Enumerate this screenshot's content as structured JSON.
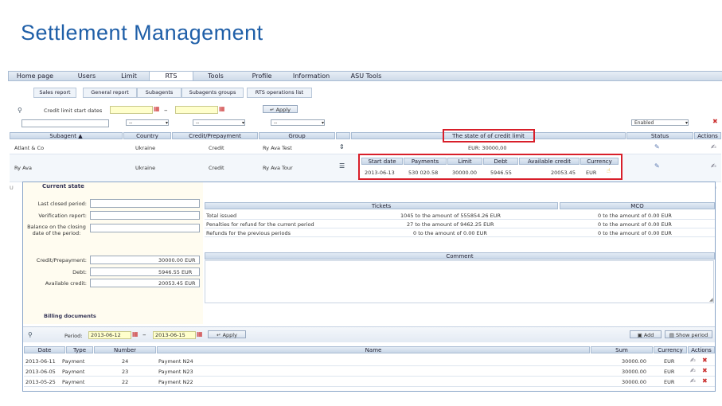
{
  "slide_title": "Settlement Management",
  "nav": [
    "Home page",
    "Users",
    "Limit",
    "RTS",
    "Tools",
    "Profile",
    "Information",
    "ASU Tools"
  ],
  "nav_active": "RTS",
  "subnav": [
    "Sales report",
    "General report",
    "Subagents",
    "Subagents groups",
    "RTS operations list"
  ],
  "filters": {
    "credit_limit_label": "Credit limit start dates",
    "dash": "–",
    "apply": "Apply",
    "sel1": "--",
    "sel2": "--",
    "sel3": "--",
    "enabled": "Enabled"
  },
  "main_table": {
    "headers": [
      "Subagent ▲",
      "Country",
      "Credit/Prepayment",
      "Group",
      "The state of of credit limit",
      "Status",
      "Actions"
    ],
    "rows": [
      {
        "subagent": "Atlant & Co",
        "country": "Ukraine",
        "credit": "Credit",
        "group": "Ry Ava Test",
        "state": "EUR: 30000,00"
      },
      {
        "subagent": "Ry Ava",
        "country": "Ukraine",
        "credit": "Credit",
        "group": "Ry Ava Tour"
      }
    ]
  },
  "credit_detail": {
    "headers": [
      "Start date",
      "Payments",
      "Limit",
      "Debt",
      "Available credit",
      "Currency"
    ],
    "values": [
      "2013-06-13",
      "530 020.58",
      "30000.00",
      "5946.55",
      "20053.45",
      "EUR"
    ]
  },
  "current_state": {
    "title": "Current state",
    "labels": [
      "Last closed period:",
      "Verification report:",
      "Balance on the closing date of the period:",
      "Credit/Prepayment:",
      "Debt:",
      "Available credit:"
    ],
    "credit_value": "30000.00 EUR",
    "debt_value": "5946.55 EUR",
    "available_value": "20053.45 EUR"
  },
  "tickets": {
    "header": "Tickets",
    "mco_header": "MCO",
    "rows": [
      {
        "label": "Total issued",
        "tickets": "1045 to the amount of 555854.26 EUR",
        "mco": "0 to the amount of 0.00 EUR"
      },
      {
        "label": "Penalties for refund for the current period",
        "tickets": "27 to the amount of 9462.25 EUR",
        "mco": "0 to the amount of 0.00 EUR"
      },
      {
        "label": "Refunds for the previous periods",
        "tickets": "0 to the amount of 0.00 EUR",
        "mco": "0 to the amount of 0.00 EUR"
      }
    ],
    "comment_header": "Comment"
  },
  "billing": {
    "title": "Billing documents",
    "period_label": "Period:",
    "from": "2013-06-12",
    "to": "2013-06-15",
    "apply": "Apply",
    "add": "Add",
    "show_period": "Show period",
    "headers": [
      "Date",
      "Type",
      "Number",
      "Name",
      "Sum",
      "Currency",
      "Actions"
    ],
    "rows": [
      {
        "date": "2013-06-11",
        "type": "Payment",
        "number": "24",
        "name": "Payment N24",
        "sum": "30000.00",
        "currency": "EUR"
      },
      {
        "date": "2013-06-05",
        "type": "Payment",
        "number": "23",
        "name": "Payment N23",
        "sum": "30000.00",
        "currency": "EUR"
      },
      {
        "date": "2013-05-25",
        "type": "Payment",
        "number": "22",
        "name": "Payment N22",
        "sum": "30000.00",
        "currency": "EUR"
      }
    ]
  }
}
